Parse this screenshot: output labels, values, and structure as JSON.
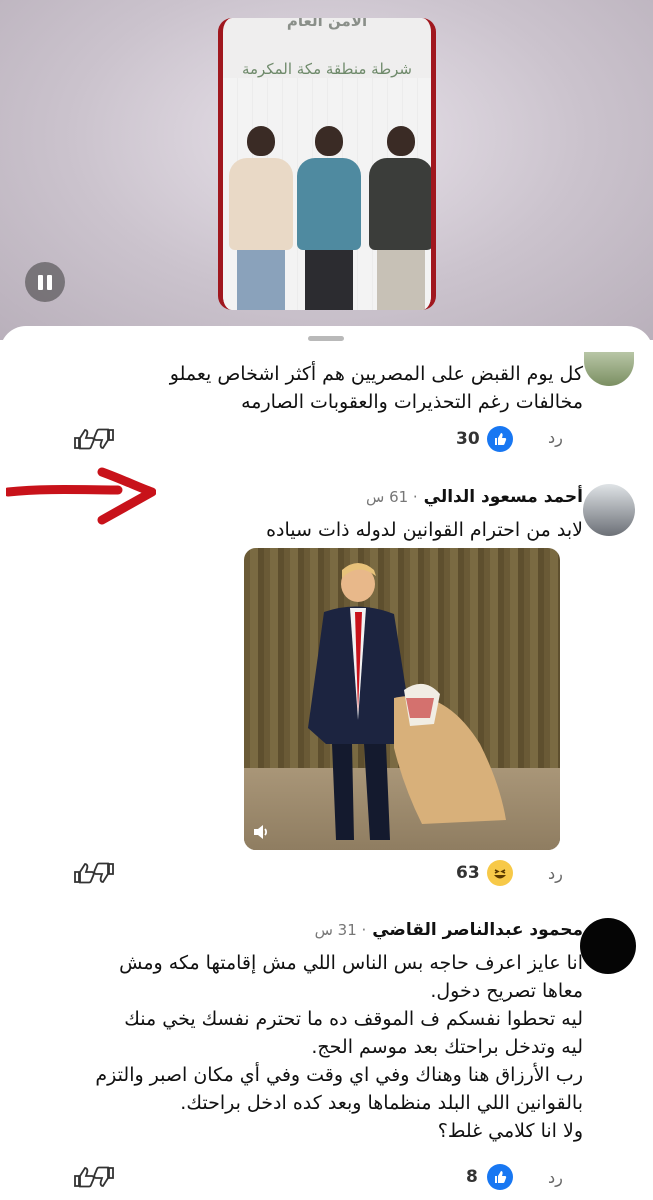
{
  "video": {
    "top_text": "الأمن العام",
    "subtitle": "شرطة منطقة مكة المكرمة"
  },
  "comments": [
    {
      "text_lines": [
        "كل يوم القبض على المصريين هم أكثر اشخاص يعملو",
        "مخالفات رغم التحذيرات والعقوبات الصارمه"
      ],
      "reaction_count": "30",
      "reply_label": "رد"
    },
    {
      "author": "أحمد مسعود الدالي",
      "time": "61 س",
      "text_lines": [
        "لابد من احترام القوانين لدوله ذات سياده"
      ],
      "reaction_count": "63",
      "reply_label": "رد"
    },
    {
      "author": "محمود عبدالناصر القاضي",
      "time": "31 س",
      "text_lines": [
        "انا عايز اعرف حاجه بس الناس اللي مش إقامتها مكه ومش",
        "معاها تصريح دخول.",
        "ليه تحطوا نفسكم ف الموقف ده ما تحترم نفسك يخي منك",
        "ليه وتدخل براحتك بعد موسم الحج.",
        "رب الأرزاق هنا وهناك وفي اي وقت وفي أي مكان اصبر والتزم",
        "بالقوانين اللي البلد منظماها وبعد كده ادخل براحتك.",
        "ولا انا كلامي غلط؟"
      ],
      "reaction_count": "8",
      "reply_label": "رد"
    }
  ],
  "colors": {
    "like_blue": "#1877f2",
    "haha_yellow": "#f7c948",
    "arrow_red": "#c8121a"
  },
  "icons": {
    "pause": "pause-icon",
    "like": "like-icon",
    "haha": "haha-icon",
    "react_thumbs": "thumbs-reaction-icon",
    "volume": "volume-icon",
    "arrow": "red-arrow"
  }
}
